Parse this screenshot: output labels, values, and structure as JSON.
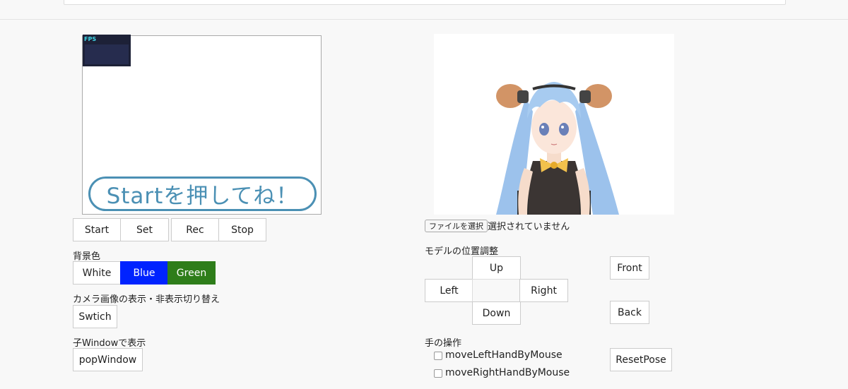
{
  "camera": {
    "fps_label": "FPS",
    "start_banner": "Startを押してね！"
  },
  "controls": {
    "start": "Start",
    "set": "Set",
    "rec": "Rec",
    "stop": "Stop"
  },
  "background": {
    "label": "背景色",
    "white": "White",
    "blue": "Blue",
    "green": "Green",
    "blue_color": "#0023ff",
    "green_color": "#2e7d1a"
  },
  "camera_toggle": {
    "label": "カメラ画像の表示・非表示切り替え",
    "button": "Swtich"
  },
  "child_window": {
    "label": "子Windowで表示",
    "button": "popWindow"
  },
  "file": {
    "button": "ファイルを選択",
    "status": "選択されていません"
  },
  "position": {
    "label": "モデルの位置調整",
    "up": "Up",
    "left": "Left",
    "right": "Right",
    "down": "Down",
    "front": "Front",
    "back": "Back"
  },
  "hands": {
    "label": "手の操作",
    "move_left": "moveLeftHandByMouse",
    "move_right": "moveRightHandByMouse",
    "reset": "ResetPose"
  }
}
